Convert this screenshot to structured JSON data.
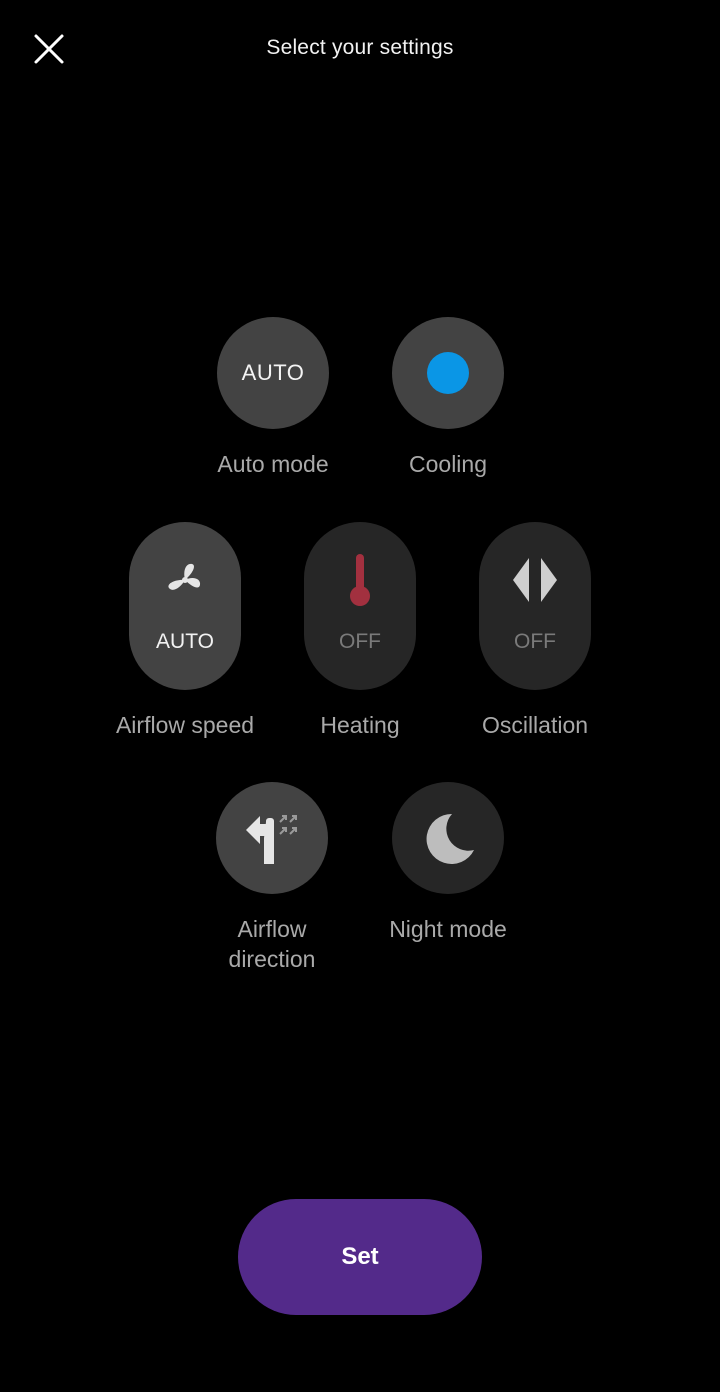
{
  "header": {
    "title": "Select your settings",
    "close_icon": "close-icon"
  },
  "controls": {
    "auto_mode": {
      "circle_text": "AUTO",
      "label": "Auto mode",
      "active": true
    },
    "cooling": {
      "icon": "blue-dot-icon",
      "label": "Cooling",
      "accent_color": "#0a96e6"
    },
    "airflow_speed": {
      "icon": "fan-icon",
      "state": "AUTO",
      "label": "Airflow speed"
    },
    "heating": {
      "icon": "thermometer-icon",
      "state": "OFF",
      "label": "Heating",
      "accent_color": "#a2303f"
    },
    "oscillation": {
      "icon": "oscillation-arrows-icon",
      "state": "OFF",
      "label": "Oscillation"
    },
    "airflow_direction": {
      "icon": "airflow-direction-icon",
      "label_line1": "Airflow",
      "label_line2": "direction"
    },
    "night_mode": {
      "icon": "moon-icon",
      "label": "Night mode"
    }
  },
  "footer": {
    "set_label": "Set",
    "set_color": "#532a8a"
  }
}
